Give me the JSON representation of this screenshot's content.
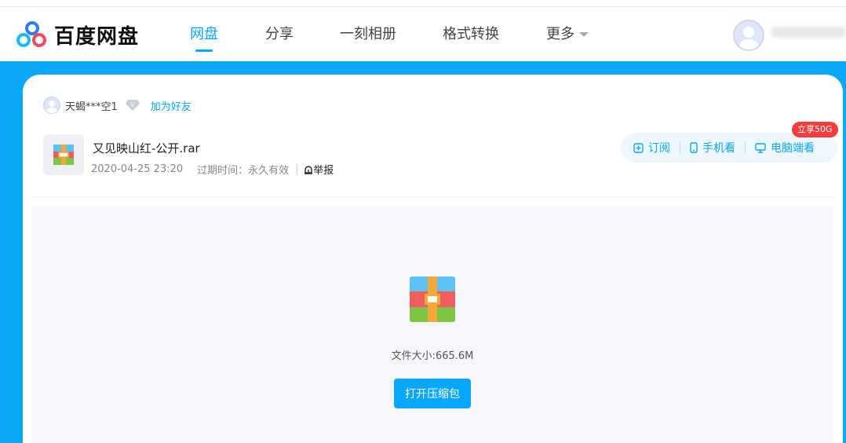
{
  "header": {
    "brand": "百度网盘",
    "nav": [
      {
        "label": "网盘",
        "active": true
      },
      {
        "label": "分享"
      },
      {
        "label": "一刻相册"
      },
      {
        "label": "格式转换"
      },
      {
        "label": "更多"
      }
    ]
  },
  "share": {
    "sharer_name": "天蝎***空1",
    "add_friend": "加为好友",
    "file_name": "又见映山红-公开.rar",
    "date": "2020-04-25 23:20",
    "expire": "过期时间：永久有效",
    "report": "举报"
  },
  "actions": {
    "subscribe": "订阅",
    "mobile": "手机看",
    "desktop": "电脑端看",
    "promo": "立享50G"
  },
  "preview": {
    "file_size": "文件大小:665.6M",
    "open_button": "打开压缩包"
  },
  "colors": {
    "accent": "#06a7ff",
    "background": "#0aa8f5",
    "promo": "#f53d3d"
  }
}
